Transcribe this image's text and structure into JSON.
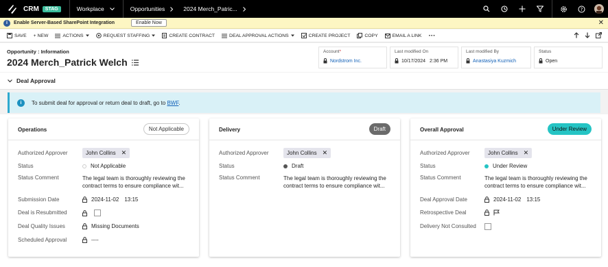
{
  "topbar": {
    "app_name": "CRM",
    "env_badge": "STAG",
    "nav": [
      "Workplace",
      "Opportunities",
      "2024 Merch_Patric..."
    ]
  },
  "banner": {
    "text": "Enable Server-Based SharePoint Integration",
    "button": "Enable Now"
  },
  "commands": [
    {
      "label": "SAVE",
      "icon": "save-icon",
      "dropdown": false
    },
    {
      "label": "+ NEW",
      "icon": "",
      "dropdown": false
    },
    {
      "label": "ACTIONS",
      "icon": "list-icon",
      "dropdown": true
    },
    {
      "label": "REQUEST STAFFING",
      "icon": "target-icon",
      "dropdown": true
    },
    {
      "label": "CREATE CONTRACT",
      "icon": "document-icon",
      "dropdown": false
    },
    {
      "label": "DEAL APPROVAL ACTIONS",
      "icon": "list-icon",
      "dropdown": true
    },
    {
      "label": "CREATE PROJECT",
      "icon": "project-icon",
      "dropdown": false
    },
    {
      "label": "COPY",
      "icon": "copy-icon",
      "dropdown": false
    },
    {
      "label": "EMAIL A LINK",
      "icon": "email-icon",
      "dropdown": false
    }
  ],
  "record": {
    "breadcrumb": "Opportunity : Information",
    "title": "2024 Merch_Patrick Welch"
  },
  "header_fields": {
    "account": {
      "label": "Account",
      "value": "Nordstrom Inc."
    },
    "modified_on": {
      "label": "Last modified On",
      "date": "10/17/2024",
      "time": "2:36 PM"
    },
    "modified_by": {
      "label": "Last modified By",
      "value": "Anastasiya Kuzmich"
    },
    "status": {
      "label": "Status",
      "value": "Open"
    }
  },
  "section": {
    "title": "Deal Approval"
  },
  "info": {
    "text": "To submit deal for approval or return deal to draft, go to ",
    "link": "BWF",
    "end": "."
  },
  "cards": {
    "operations": {
      "title": "Operations",
      "pill": "Not Applicable",
      "fields": {
        "approver": {
          "label": "Authorized Approver",
          "value": "John Collins"
        },
        "status": {
          "label": "Status",
          "value": "Not Applicable"
        },
        "comment": {
          "label": "Status Comment",
          "value": "The legal team is thoroughly reviewing the contract terms to ensure compliance wit..."
        },
        "submission": {
          "label": "Submission Date",
          "date": "2024-11-02",
          "time": "13:15"
        },
        "resubmitted": {
          "label": "Deal is Resubmitted"
        },
        "quality": {
          "label": "Deal Quality Issues",
          "value": "Missing Documents"
        },
        "scheduled": {
          "label": "Scheduled Approval",
          "value": "----"
        }
      }
    },
    "delivery": {
      "title": "Delivery",
      "pill": "Draft",
      "fields": {
        "approver": {
          "label": "Authorized Approver",
          "value": "John Collins"
        },
        "status": {
          "label": "Status",
          "value": "Draft"
        },
        "comment": {
          "label": "Status Comment",
          "value": "The legal team is thoroughly reviewing the contract terms to ensure compliance wit..."
        }
      }
    },
    "overall": {
      "title": "Overall Approval",
      "pill": "Under Review",
      "fields": {
        "approver": {
          "label": "Authorized Approver",
          "value": "John Collins"
        },
        "status": {
          "label": "Status",
          "value": "Under Review"
        },
        "comment": {
          "label": "Status Comment",
          "value": "The legal team is thoroughly reviewing the contract terms to ensure compliance wit..."
        },
        "approval_date": {
          "label": "Deal Approval Date",
          "date": "2024-11-02",
          "time": "13:15"
        },
        "retrospective": {
          "label": "Retrospective Deal"
        },
        "not_consulted": {
          "label": "Delivery Not Consulted"
        }
      }
    }
  },
  "colors": {
    "not_applicable_dot": "#ffffff",
    "draft_dot": "#555555",
    "under_review_dot": "#25c4c4",
    "stag_badge": "#3bbd9c",
    "link": "#1160b7"
  }
}
